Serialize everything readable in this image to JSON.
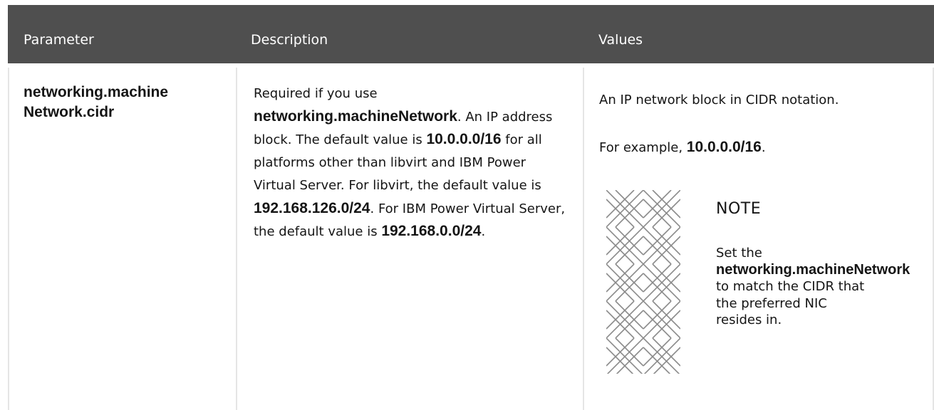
{
  "table": {
    "headers": [
      "Parameter",
      "Description",
      "Values"
    ],
    "row": {
      "parameter_line1": "networking.machine",
      "parameter_line2": "Network.cidr",
      "description": [
        {
          "text": "Required if you use ",
          "bold": false
        },
        {
          "text": "networking.machineNetwork",
          "bold": true
        },
        {
          "text": ". An IP address block. The default value is ",
          "bold": false
        },
        {
          "text": "10.0.0.0/16",
          "bold": true
        },
        {
          "text": " for all platforms other than libvirt and IBM Power Virtual Server. For libvirt, the default value is ",
          "bold": false
        },
        {
          "text": "192.168.126.0/24",
          "bold": true
        },
        {
          "text": ". For IBM Power Virtual Server, the default value is ",
          "bold": false
        },
        {
          "text": "192.168.0.0/24",
          "bold": true
        },
        {
          "text": ".",
          "bold": false
        }
      ],
      "values": {
        "line1": "An IP network block in CIDR notation.",
        "example_prefix": "For example, ",
        "example_value": "10.0.0.0/16",
        "example_suffix": ".",
        "note": {
          "icon": "note-pattern-icon",
          "title": "NOTE",
          "text_prefix": "Set the ",
          "text_bold": "networking.machineNetwork",
          "text_suffix": " to match the CIDR that the preferred NIC resides in."
        }
      }
    }
  },
  "colors": {
    "header_bg": "#4f4f4f",
    "header_text": "#ffffff",
    "divider": "#e5e5e5",
    "text": "#151515"
  }
}
